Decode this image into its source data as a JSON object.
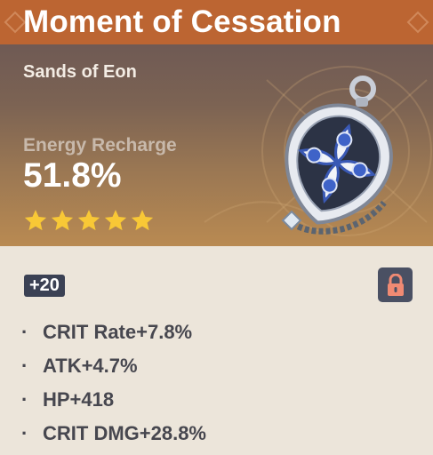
{
  "artifact": {
    "name": "Moment of Cessation",
    "set_name": "Sands of Eon",
    "main_stat": {
      "label": "Energy Recharge",
      "value": "51.8%"
    },
    "rarity_stars": 5,
    "level": "+20",
    "locked": true,
    "substats": [
      {
        "text": "CRIT Rate+7.8%"
      },
      {
        "text": "ATK+4.7%"
      },
      {
        "text": "HP+418"
      },
      {
        "text": "CRIT DMG+28.8%"
      }
    ]
  },
  "icons": {
    "star": "star-icon",
    "lock": "lock-icon",
    "bullet": "·"
  },
  "colors": {
    "header": "#bc6532",
    "star": "#f8c836",
    "lock_bg": "#4a5063",
    "lock_icon": "#f08a73",
    "level_bg": "#3b4154",
    "card_bg": "#ece5da"
  }
}
